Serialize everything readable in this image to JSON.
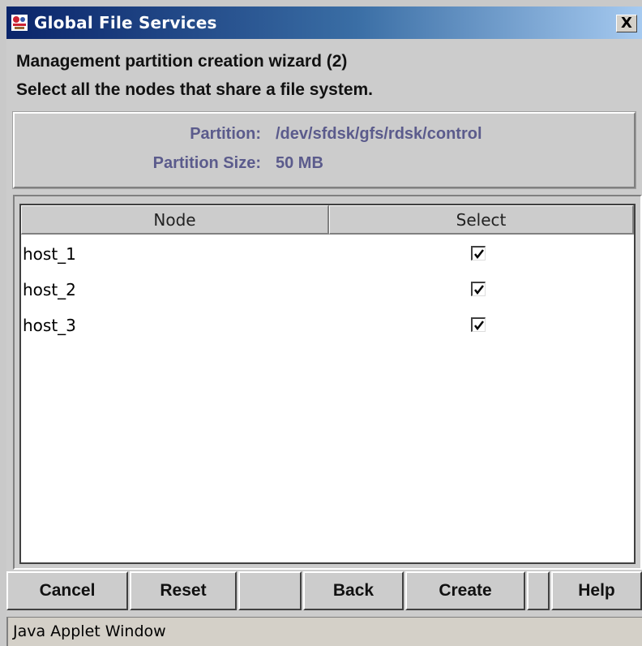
{
  "window": {
    "title": "Global File Services",
    "close_label": "X",
    "app_icon": "gfs-app-icon",
    "close_icon": "close-icon"
  },
  "header": {
    "line1": "Management partition creation wizard (2)",
    "line2": "Select all the nodes that share a file system."
  },
  "info": {
    "partition_label": "Partition:",
    "partition_value": "/dev/sfdsk/gfs/rdsk/control",
    "size_label": "Partition Size:",
    "size_value": "50 MB"
  },
  "table": {
    "columns": [
      "Node",
      "Select"
    ],
    "rows": [
      {
        "node": "host_1",
        "selected": true
      },
      {
        "node": "host_2",
        "selected": true
      },
      {
        "node": "host_3",
        "selected": true
      }
    ]
  },
  "buttons": {
    "cancel": "Cancel",
    "reset": "Reset",
    "back": "Back",
    "create": "Create",
    "help": "Help"
  },
  "status": {
    "text": "Java Applet Window"
  },
  "colors": {
    "titlebar_start": "#0a246a",
    "titlebar_end": "#a6caf0",
    "info_text": "#5b5b8c",
    "window_bg": "#cccccc"
  }
}
